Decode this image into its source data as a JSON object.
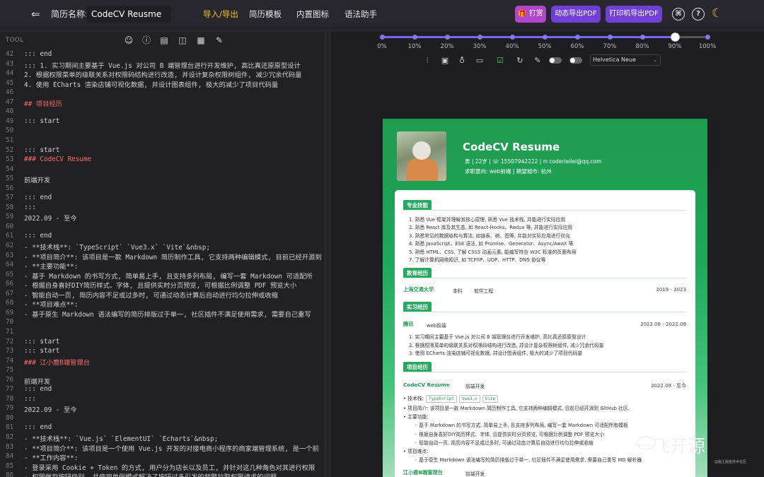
{
  "topbar": {
    "name_label": "简历名称:",
    "name_value": "CodeCV Reusme",
    "nav": [
      "导入/导出",
      "简历模板",
      "内置图标",
      "语法助手"
    ],
    "reward": "打赏",
    "dynamic_pdf": "动态导出PDF",
    "print_pdf": "打印机导出PDF"
  },
  "editor": {
    "tool_label": "TOOL",
    "lines": [
      [
        "42",
        ":::  end",
        ""
      ],
      [
        "43",
        ":::  1. 实习期间主要基于 Vue.js 对公司 B 端管理台进行开发维护, 高比真还原原型设计",
        ""
      ],
      [
        "44",
        "2. 根据权限菜单的级联关系对权限码结构进行改造, 并设计复杂权限树组件, 减少冗余代码量",
        ""
      ],
      [
        "45",
        "4. 使用 ECharts 渲染店铺可视化数据, 并设计图表组件, 极大的减少了项目代码量",
        ""
      ],
      [
        "46",
        "",
        ""
      ],
      [
        "47",
        "## 项目经历",
        "h"
      ],
      [
        "48",
        "",
        ""
      ],
      [
        "49",
        "::: start",
        ""
      ],
      [
        "50",
        "",
        ""
      ],
      [
        "51",
        "",
        ""
      ],
      [
        "52",
        "::: start",
        ""
      ],
      [
        "53",
        "### CodeCV Resume",
        "h"
      ],
      [
        "54",
        "",
        ""
      ],
      [
        "55",
        "前端开发",
        ""
      ],
      [
        "56",
        "",
        ""
      ],
      [
        "57",
        "::: end",
        ""
      ],
      [
        "58",
        ":::",
        ""
      ],
      [
        "59",
        "2022.09 - 至今",
        ""
      ],
      [
        "60",
        "",
        ""
      ],
      [
        "61",
        "::: end",
        ""
      ],
      [
        "62",
        "- **技术栈**:  `TypeScript` `Vue3.x` `Vite`&nbsp;",
        ""
      ],
      [
        "63",
        "- **项目简介**: 该项目是一款 Markdown 简历制作工具, 它支持两种编辑模式, 目前已经开源到",
        ""
      ],
      [
        "64",
        "- **主要功能**:",
        ""
      ],
      [
        "65",
        "  - 基于 Markdown 的书写方式, 简单易上手, 且支持多列布局, 编写一套 Markdown 可适配所",
        ""
      ],
      [
        "66",
        "  - 根据自身喜好DIY简历样式、字体, 且提供实时分页预览, 可根据比例调整 PDF 预览大小",
        ""
      ],
      [
        "67",
        "  - 智能自动一页, 简历内容不足或过多时, 可通过动态计算后自动进行均匀拉伸或收缩",
        ""
      ],
      [
        "68",
        "- **项目难点**:",
        ""
      ],
      [
        "69",
        "  - 基于原生 Markdown 语法编写的简历排版过于单一, 社区插件不满足使用需求, 需要自己重写",
        ""
      ],
      [
        "70",
        "",
        ""
      ],
      [
        "71",
        "",
        ""
      ],
      [
        "72",
        "::: start",
        ""
      ],
      [
        "73",
        "::: start",
        ""
      ],
      [
        "74",
        "### 江小鹿B端管理台",
        "h"
      ],
      [
        "75",
        "",
        ""
      ],
      [
        "76",
        "前端开发",
        ""
      ],
      [
        "77",
        "::: end",
        ""
      ],
      [
        "78",
        ":::",
        ""
      ],
      [
        "79",
        "2022.09 - 至今",
        ""
      ],
      [
        "80",
        "",
        ""
      ],
      [
        "81",
        "::: end",
        ""
      ],
      [
        "82",
        "- **技术栈**:  `Vue.js` `ElementUI` `Echarts`&nbsp;",
        ""
      ],
      [
        "83",
        "- **项目简介**: 该项目是一个使用 Vue.js 开发的对接电商小程序的商家端管理系统, 是一个前",
        ""
      ],
      [
        "84",
        "- **工作内容**:",
        ""
      ],
      [
        "85",
        "  - 登录采用 Cookie + Token 的方式, 用户分为店长以及员工, 并针对这几种角色对其进行权限",
        ""
      ],
      [
        "86",
        "  - 权限做到按钮级别, 并使用单例模式解决了按钮过多引发的频繁拉取权限请求的问题",
        ""
      ]
    ]
  },
  "preview": {
    "zoom_ticks": [
      "0%",
      "10%",
      "20%",
      "30%",
      "40%",
      "50%",
      "60%",
      "70%",
      "80%",
      "90%",
      "100%"
    ],
    "zoom_value": 0.9,
    "font": "Helvetica Neue"
  },
  "resume": {
    "name": "CodeCV Resume",
    "info1": "男  |  22岁  |  ☏ 15507942222  |  ✉ coderleilei@qq.com",
    "info2": "求职意向: web前端  |  期望城市: 杭州",
    "skills_title": "专业技能",
    "skills": [
      "1. 熟悉 Vue 框架并理解其核心原理, 熟悉 Vue 技术栈, 并能进行实际应用",
      "2. 熟悉 React 库及其生态, 如 React-Hooks、Redux 等, 并能进行实际应用",
      "3. 熟悉常见的数据结构与算法, 如链表、树、图等, 并能对实际应用进行优化",
      "4. 熟悉 JavaScript、ES6 语法, 如 Promise、Generator、Async/Await 等",
      "5. 熟悉 HTML、CSS, 了解 CSS3 动画元素, 能编写符合 W3C 标准的页面布局",
      "7. 了解计算机网络知识, 如 TCP/IP、UDP、HTTP、DNS 协议等"
    ],
    "edu_title": "教育经历",
    "school": "上海交通大学",
    "degree": "本科",
    "major": "软件工程",
    "edu_date": "2019 - 2023",
    "intern_title": "实习经历",
    "company": "腾讯",
    "role": "web前端",
    "intern_date": "2022.06 - 2022.09",
    "intern_items": [
      "1. 实习期间主要基于 Vue.js 对公司 B 端管理台进行开发维护, 高比真还原原型设计",
      "2. 根据权限菜单的级联关系对权限码结构进行改造, 并设计复杂权限树组件, 减少冗余代码量",
      "3. 使用 ECharts 渲染店铺可视化数据, 并设计图表组件, 极大的减少了项目代码量"
    ],
    "proj_title": "项目经历",
    "proj1_name": "CodeCV Resume",
    "proj1_role": "前端开发",
    "proj1_date": "2022.09 - 至今",
    "stack_label": "技术栈:",
    "stack": [
      "TypeScript",
      "Vue3.x",
      "Vite"
    ],
    "proj1_items": [
      "项目简介: 该项目是一款 Markdown 简历制作工具, 它支持两种编辑模式, 目前已经开源到 GitHub 社区.",
      "主要功能:",
      "基于 Markdown 的书写方式, 简单易上手, 且支持多列布局, 编写一套 Markdown 可适配所有模板",
      "根据自身喜好DIY简历样式、字体, 且提供实时分页预览, 可根据比例调整 PDF 预览大小",
      "智能自动一页, 简历内容不足或过多时, 可通过动态计算后自动进行均匀拉伸或收缩",
      "项目难点:",
      "基于原生 Markdown 语法编写的简历排版过于单一, 社区插件不满足使用需求, 需要自己重写 MD 解析器"
    ],
    "proj2_name": "江小鹿B端管理台",
    "proj2_role": "前端开发"
  },
  "watermark": {
    "text": "一飞开源",
    "sub": "@掘土掘金技术社区"
  }
}
